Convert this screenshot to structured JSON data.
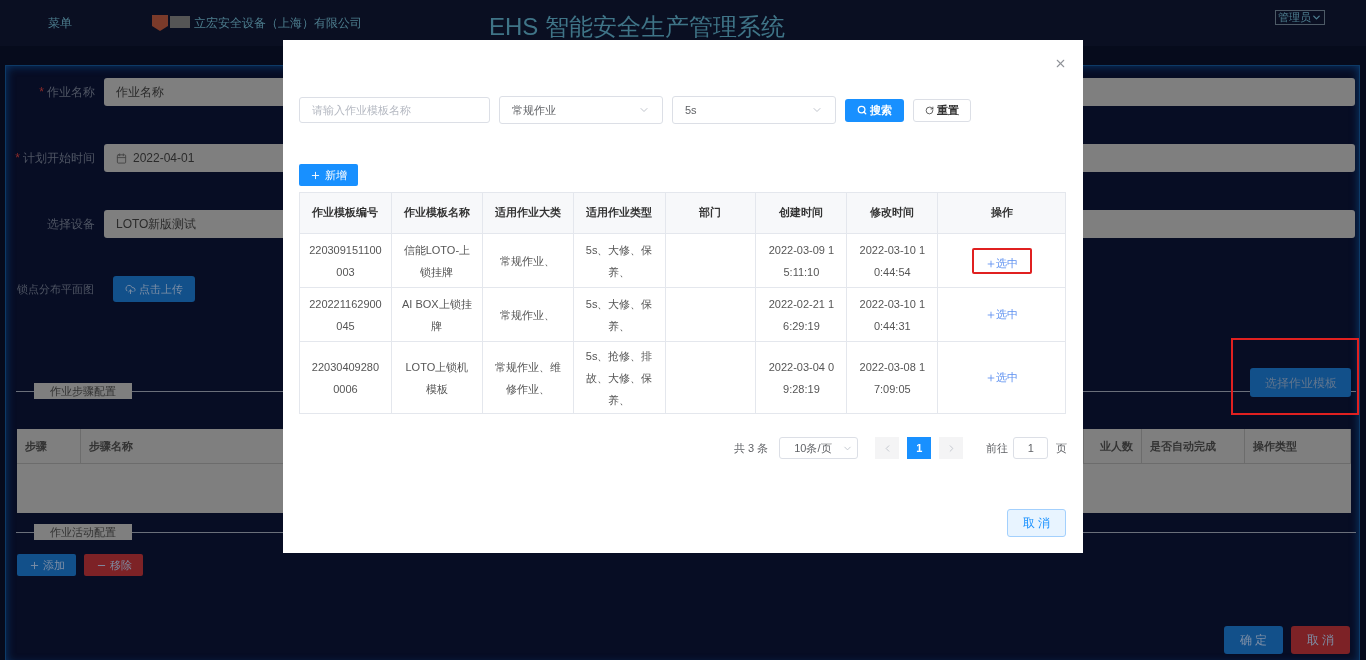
{
  "header": {
    "menu": "菜单",
    "company": "立宏安全设备（上海）有限公司",
    "title": "EHS 智能安全生产管理系统",
    "user": "管理员"
  },
  "form": {
    "required_mark": "*",
    "fields": [
      {
        "label": "作业名称",
        "required": true,
        "value": "作业名称",
        "kind": "text"
      },
      {
        "label": "计划开始时间",
        "required": true,
        "value": "2022-04-01",
        "kind": "date"
      },
      {
        "label": "选择设备",
        "required": false,
        "value": "LOTO新版测试",
        "kind": "text"
      }
    ],
    "upload": {
      "label": "锁点分布平面图",
      "button": "点击上传"
    }
  },
  "steps_section": {
    "title": "作业步骤配置",
    "button": "选择作业模板",
    "highlighted": true,
    "columns": [
      "步骤",
      "步骤名称",
      "业人数",
      "是否自动完成",
      "操作类型"
    ]
  },
  "activity_section": {
    "title": "作业活动配置",
    "buttons": [
      {
        "label": "添加",
        "kind": "add"
      },
      {
        "label": "移除",
        "kind": "remove"
      }
    ]
  },
  "footer_buttons": [
    {
      "label": "确 定",
      "kind": "primary"
    },
    {
      "label": "取 消",
      "kind": "danger"
    }
  ],
  "dialog": {
    "search_placeholder": "请输入作业模板名称",
    "category": "常规作业",
    "type": "5s",
    "search_button": "搜索",
    "reset_button": "重置",
    "add_button": "新增",
    "columns": [
      "作业模板编号",
      "作业模板名称",
      "适用作业大类",
      "适用作业类型",
      "部门",
      "创建时间",
      "修改时间",
      "操作"
    ],
    "rows": [
      {
        "cells": [
          "220309151100003",
          "信能LOTO-上锁挂牌",
          "常规作业、",
          "5s、大修、保养、",
          "",
          "2022-03-09 15:11:10",
          "2022-03-10 10:44:54"
        ],
        "action": "选中",
        "highlighted": true
      },
      {
        "cells": [
          "220221162900045",
          "AI BOX上锁挂牌",
          "常规作业、",
          "5s、大修、保养、",
          "",
          "2022-02-21 16:29:19",
          "2022-03-10 10:44:31"
        ],
        "action": "选中",
        "highlighted": false
      },
      {
        "cells": [
          "220304092800006",
          "LOTO上锁机模板",
          "常规作业、维修作业、",
          "5s、抢修、排故、大修、保养、",
          "",
          "2022-03-04 09:28:19",
          "2022-03-08 17:09:05"
        ],
        "action": "选中",
        "highlighted": false
      }
    ],
    "pagination": {
      "total": "共 3 条",
      "page_size": "10条/页",
      "pages": [
        {
          "label": "1",
          "selected": true
        }
      ],
      "goto": "前往",
      "goto_value": "1",
      "suffix": "页"
    },
    "cancel_button": "取 消"
  }
}
